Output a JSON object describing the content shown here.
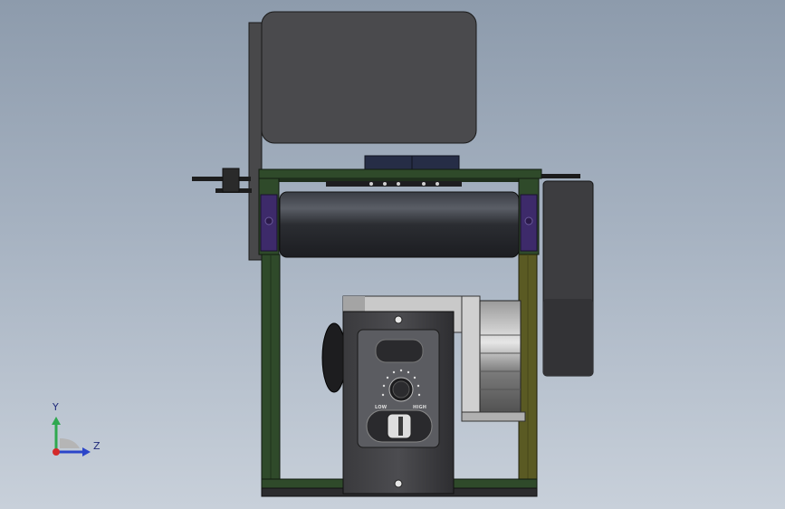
{
  "viewport": {
    "background_top": "#8d9bac",
    "background_bottom": "#c8d0da"
  },
  "triad": {
    "y_label": "Y",
    "z_label": "Z",
    "y_color": "#2fa84f",
    "z_color": "#2b45c9",
    "origin_color": "#d42a2a"
  },
  "controller": {
    "low_label": "LOW",
    "high_label": "HIGH"
  },
  "colors": {
    "frame_green": "#2f4a2a",
    "frame_yellow": "#5a5a23",
    "bracket_purple": "#3d2a6a",
    "dark_gray": "#3c3c3e",
    "roller": "#2a2c30",
    "body_gray": "#4a4b4f"
  }
}
